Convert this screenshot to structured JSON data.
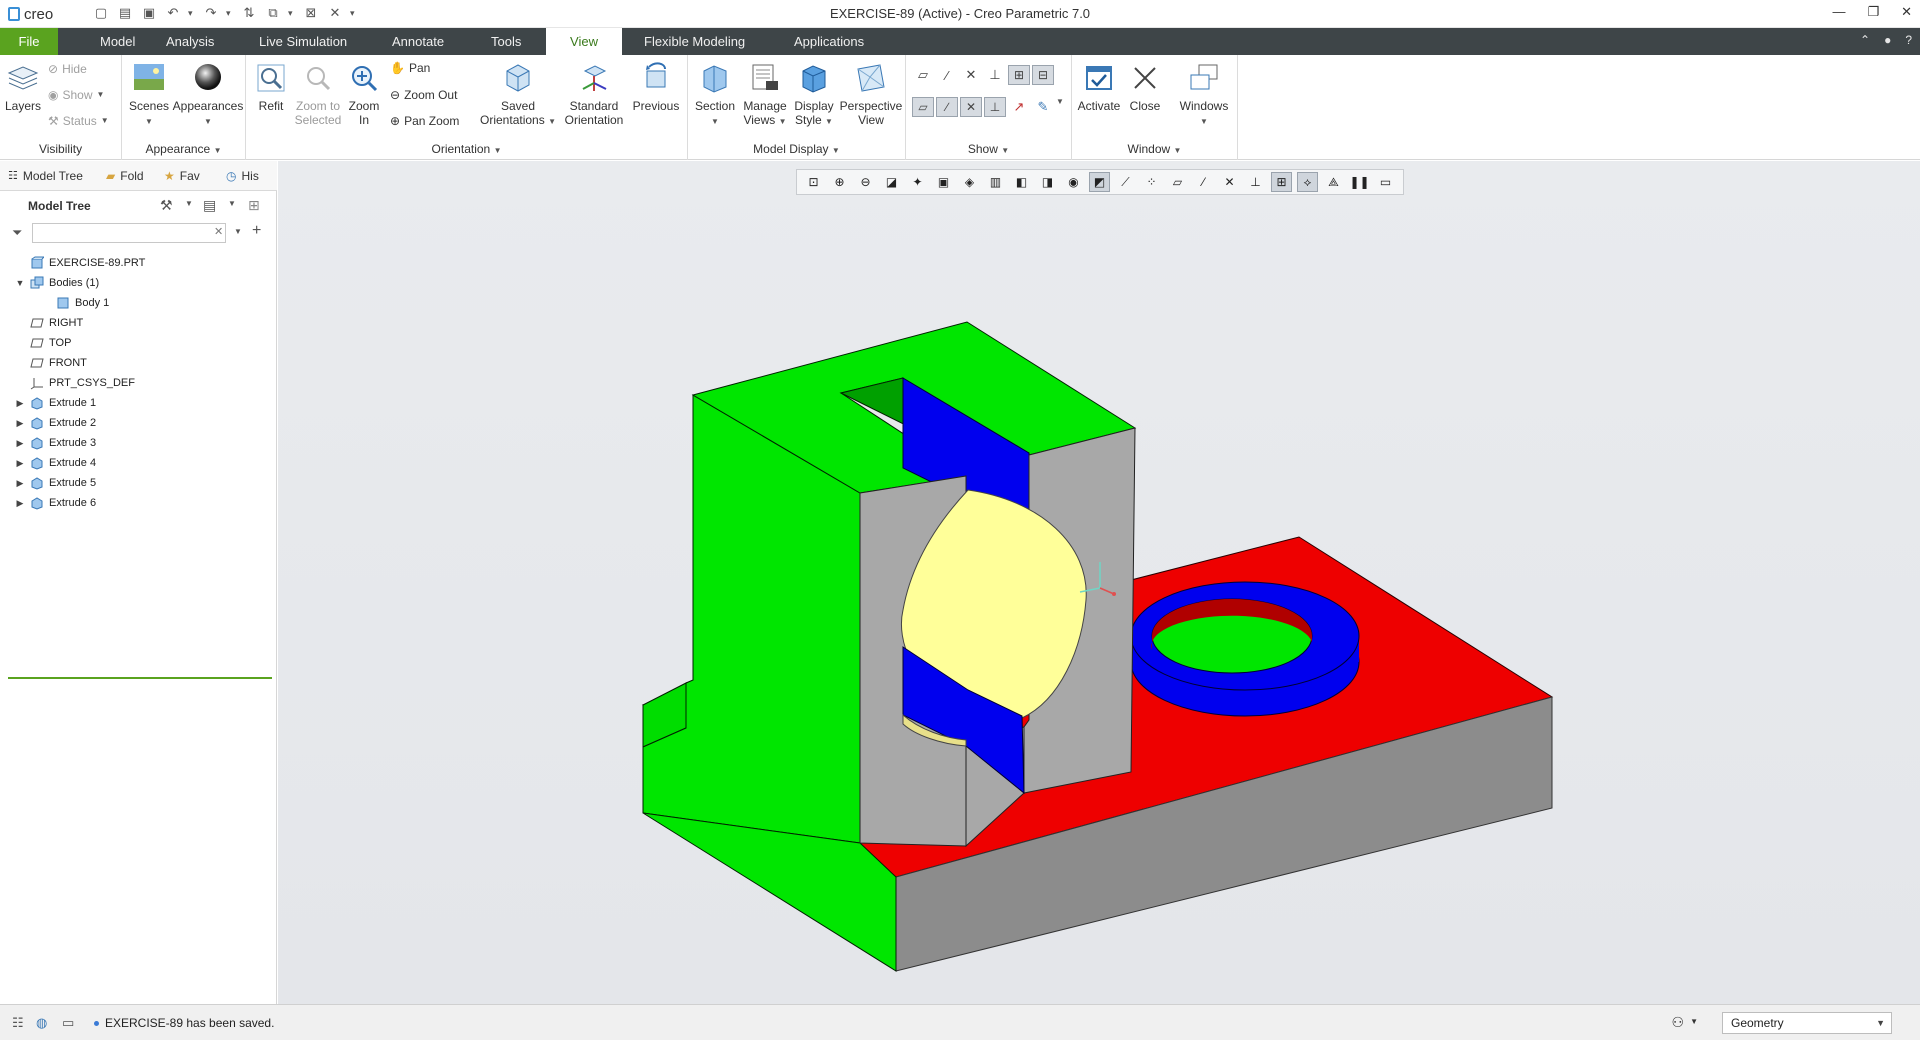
{
  "app": {
    "brand": "creo",
    "window_title": "EXERCISE-89 (Active) - Creo Parametric 7.0"
  },
  "tabs": [
    {
      "label": "File",
      "active": false
    },
    {
      "label": "Model",
      "active": false
    },
    {
      "label": "Analysis",
      "active": false
    },
    {
      "label": "Live Simulation",
      "active": false
    },
    {
      "label": "Annotate",
      "active": false
    },
    {
      "label": "Tools",
      "active": false
    },
    {
      "label": "View",
      "active": true
    },
    {
      "label": "Flexible Modeling",
      "active": false
    },
    {
      "label": "Applications",
      "active": false
    }
  ],
  "ribbon": {
    "visibility": {
      "label": "Visibility",
      "layers": "Layers",
      "hide": "Hide",
      "show": "Show",
      "status": "Status"
    },
    "appearance": {
      "label": "Appearance",
      "scenes": "Scenes",
      "appearances": "Appearances"
    },
    "orientation": {
      "label": "Orientation",
      "refit": "Refit",
      "zoom_to_selected_1": "Zoom to",
      "zoom_to_selected_2": "Selected",
      "zoom_in_1": "Zoom",
      "zoom_in_2": "In",
      "pan": "Pan",
      "zoom_out": "Zoom Out",
      "pan_zoom": "Pan Zoom",
      "saved_1": "Saved",
      "saved_2": "Orientations",
      "standard_1": "Standard",
      "standard_2": "Orientation",
      "previous": "Previous"
    },
    "model_display": {
      "label": "Model Display",
      "section": "Section",
      "manage_1": "Manage",
      "manage_2": "Views",
      "display_1": "Display",
      "display_2": "Style",
      "perspective_1": "Perspective",
      "perspective_2": "View"
    },
    "show": {
      "label": "Show"
    },
    "window": {
      "label": "Window",
      "activate": "Activate",
      "close": "Close",
      "windows": "Windows"
    }
  },
  "navigator": {
    "tabs": [
      "Model Tree",
      "Fold",
      "Fav",
      "His"
    ],
    "tree_title": "Model Tree",
    "filter_placeholder": ""
  },
  "tree": [
    {
      "label": "EXERCISE-89.PRT",
      "icon": "part-icon",
      "level": 0,
      "expander": ""
    },
    {
      "label": "Bodies (1)",
      "icon": "bodies-icon",
      "level": 0,
      "expander": "▼"
    },
    {
      "label": "Body 1",
      "icon": "body-icon",
      "level": 1,
      "expander": ""
    },
    {
      "label": "RIGHT",
      "icon": "datum-plane-icon",
      "level": 0,
      "expander": ""
    },
    {
      "label": "TOP",
      "icon": "datum-plane-icon",
      "level": 0,
      "expander": ""
    },
    {
      "label": "FRONT",
      "icon": "datum-plane-icon",
      "level": 0,
      "expander": ""
    },
    {
      "label": "PRT_CSYS_DEF",
      "icon": "csys-icon",
      "level": 0,
      "expander": ""
    },
    {
      "label": "Extrude 1",
      "icon": "extrude-icon",
      "level": 0,
      "expander": "▶"
    },
    {
      "label": "Extrude 2",
      "icon": "extrude-icon",
      "level": 0,
      "expander": "▶"
    },
    {
      "label": "Extrude 3",
      "icon": "extrude-icon",
      "level": 0,
      "expander": "▶"
    },
    {
      "label": "Extrude 4",
      "icon": "extrude-icon",
      "level": 0,
      "expander": "▶"
    },
    {
      "label": "Extrude 5",
      "icon": "extrude-icon",
      "level": 0,
      "expander": "▶"
    },
    {
      "label": "Extrude 6",
      "icon": "extrude-icon",
      "level": 0,
      "expander": "▶"
    }
  ],
  "status": {
    "message": "EXERCISE-89 has been saved.",
    "selection_filter": "Geometry"
  },
  "colors": {
    "file_tab": "#5aa31f",
    "tab_bar": "#3e4548",
    "face_green": "#00e600",
    "face_red": "#ee0000",
    "face_blue": "#0000ee",
    "face_gray": "#a8a8a8",
    "face_yellow": "#ffff99"
  }
}
